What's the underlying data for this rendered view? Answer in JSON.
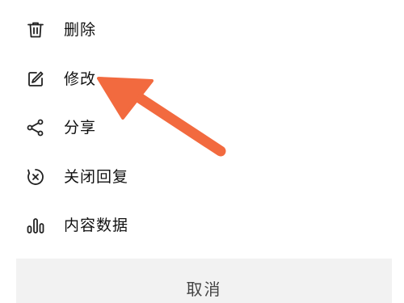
{
  "menu": {
    "items": [
      {
        "label": "删除",
        "icon": "trash-icon"
      },
      {
        "label": "修改",
        "icon": "edit-icon"
      },
      {
        "label": "分享",
        "icon": "share-icon"
      },
      {
        "label": "关闭回复",
        "icon": "close-circle-icon"
      },
      {
        "label": "内容数据",
        "icon": "bar-chart-icon"
      }
    ]
  },
  "cancel": {
    "label": "取消"
  },
  "colors": {
    "annotation_arrow": "#f26a3f",
    "cancel_bg": "#f2f2f2",
    "text": "#111111"
  }
}
